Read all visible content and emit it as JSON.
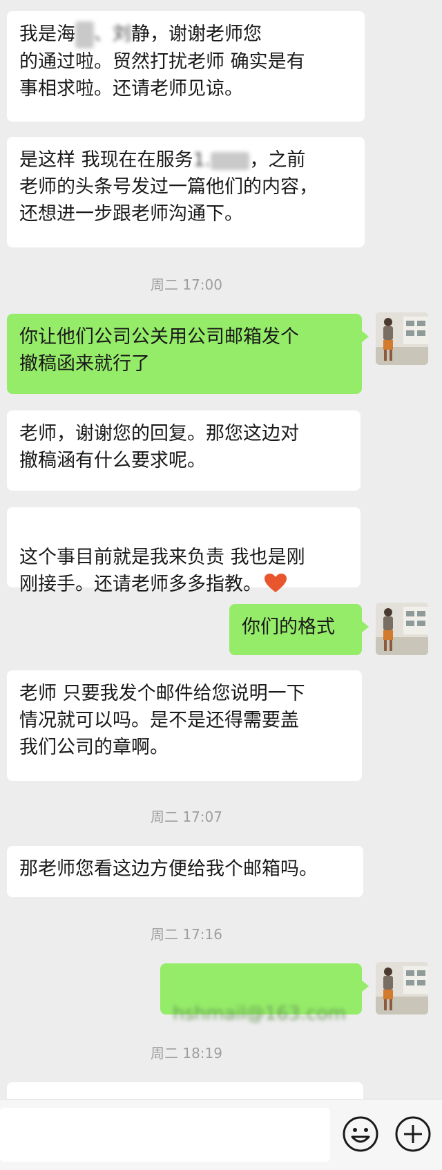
{
  "messages": [
    {
      "type": "in",
      "text_a": "我是海",
      "text_b": "唐",
      "text_c": "、刘",
      "text_d": "静，谢谢老师您\n的通过啦。贸然打扰老师 确实是有\n事相求啦。还请老师见谅。"
    },
    {
      "type": "in",
      "text_a": "是这样 我现在在服务",
      "text_b": "1.",
      "text_c": "，之前\n老师的头条号发过一篇他们的内容，\n还想进一步跟老师沟通下。"
    },
    {
      "type": "time",
      "text": "周二 17:00"
    },
    {
      "type": "out",
      "text": "你让他们公司公关用公司邮箱发个\n撤稿函来就行了"
    },
    {
      "type": "in",
      "text": "老师，谢谢您的回复。那您这边对\n撤稿涵有什么要求呢。"
    },
    {
      "type": "in",
      "text": "这个事目前就是我来负责 我也是刚\n刚接手。还请老师多多指教。",
      "emoji": "heart-emoji"
    },
    {
      "type": "out",
      "text": "你们的格式"
    },
    {
      "type": "in",
      "text": "老师 只要我发个邮件给您说明一下\n情况就可以吗。是不是还得需要盖\n我们公司的章啊。"
    },
    {
      "type": "time",
      "text": "周二 17:07"
    },
    {
      "type": "in",
      "text": "那老师您看这边方便给我个邮箱吗。"
    },
    {
      "type": "time",
      "text": "周二 17:16"
    },
    {
      "type": "out",
      "text": "hshmail@163.com",
      "blurred": true
    },
    {
      "type": "time",
      "text": "周二 18:19"
    }
  ],
  "input_bar": {
    "icons": [
      "emoji-icon",
      "plus-icon"
    ]
  },
  "colors": {
    "background": "#ededed",
    "incoming_bubble": "#ffffff",
    "outgoing_bubble": "#95ec69",
    "timestamp": "#9e9e9e"
  }
}
